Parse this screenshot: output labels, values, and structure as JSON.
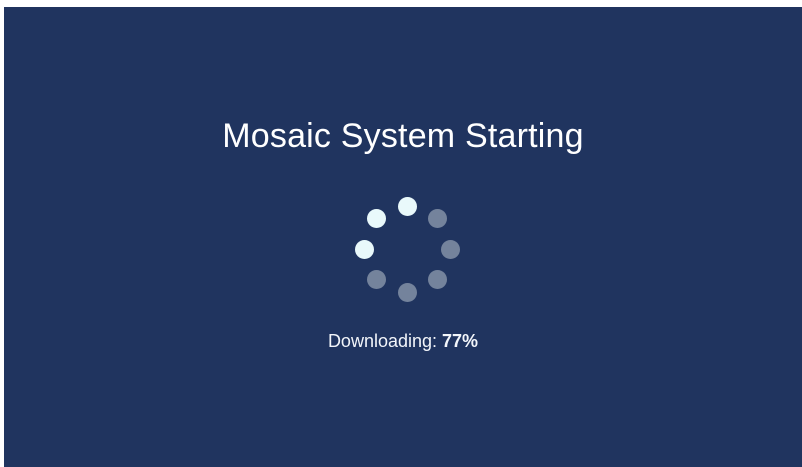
{
  "app": {
    "title": "Mosaic System Starting",
    "status_label": "Downloading:",
    "status_value": "77%"
  },
  "progress": {
    "percent": 77
  },
  "spinner": {
    "icon": "loading-spinner-icon",
    "dot_count": 8,
    "active_color": "#e9f9fb",
    "inactive_color": "#74839c"
  },
  "colors": {
    "background": "#20345f",
    "text": "#ffffff"
  }
}
